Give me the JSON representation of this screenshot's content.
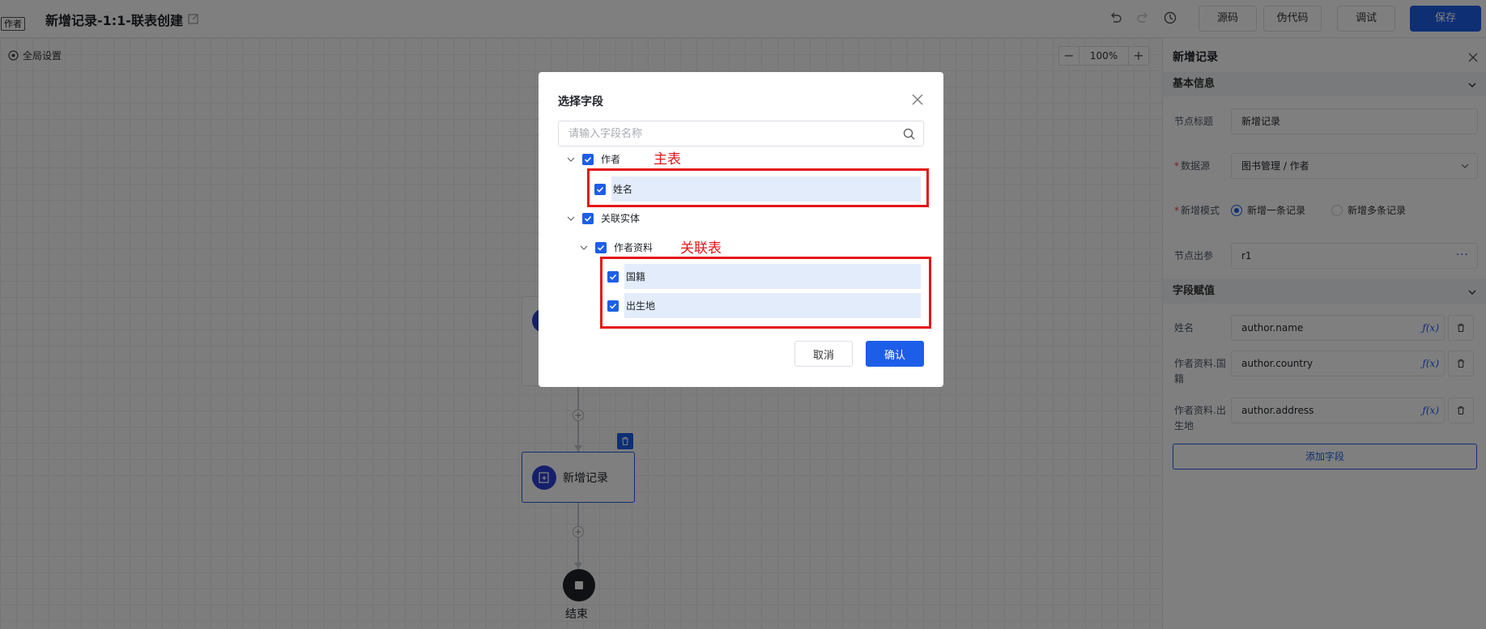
{
  "header": {
    "tag": "作者",
    "title": "新增记录-1:1-联表创建",
    "buttons": {
      "source": "源码",
      "pseudo": "伪代码",
      "debug": "调试",
      "save": "保存"
    }
  },
  "canvas": {
    "global_settings": "全局设置",
    "zoom": "100%",
    "add_node_label": "新增记录",
    "end_label": "结束"
  },
  "panel": {
    "title": "新增记录",
    "basic_section": "基本信息",
    "fields": {
      "node_title_label": "节点标题",
      "node_title_value": "新增记录",
      "datasource_label": "数据源",
      "datasource_value": "图书管理 / 作者",
      "mode_label": "新增模式",
      "mode_single": "新增一条记录",
      "mode_multi": "新增多条记录",
      "output_label": "节点出参",
      "output_value": "r1"
    },
    "assign_section": "字段赋值",
    "assignments": [
      {
        "label": "姓名",
        "value": "author.name"
      },
      {
        "label": "作者资料.国籍",
        "value": "author.country"
      },
      {
        "label": "作者资料.出生地",
        "value": "author.address"
      }
    ],
    "add_field": "添加字段"
  },
  "modal": {
    "title": "选择字段",
    "search_placeholder": "请输入字段名称",
    "tree": {
      "root": "作者",
      "root_child": "姓名",
      "relation": "关联实体",
      "relation_entity": "作者资料",
      "relation_fields": [
        "国籍",
        "出生地"
      ]
    },
    "cancel": "取消",
    "confirm": "确认"
  },
  "annotations": {
    "main_table": "主表",
    "related_table": "关联表"
  },
  "colors": {
    "primary": "#1d5ee8",
    "annotation": "#e51616",
    "selected_row": "#e3ecfb"
  }
}
